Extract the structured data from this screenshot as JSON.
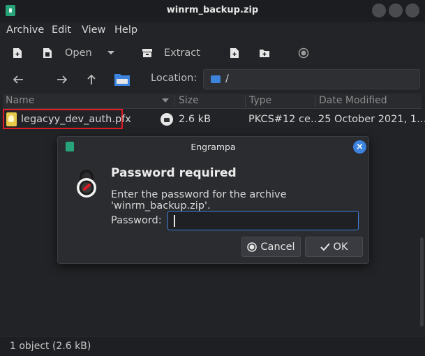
{
  "window": {
    "title": "winrm_backup.zip"
  },
  "menu": [
    "Archive",
    "Edit",
    "View",
    "Help"
  ],
  "toolbar": {
    "open_label": "Open",
    "extract_label": "Extract"
  },
  "location": {
    "label": "Location:",
    "path": "/"
  },
  "columns": {
    "name": "Name",
    "size": "Size",
    "type": "Type",
    "modified": "Date Modified"
  },
  "files": [
    {
      "name": "legacyy_dev_auth.pfx",
      "size": "2.6 kB",
      "type": "PKCS#12 ce…",
      "modified": "25 October 2021, 1…"
    }
  ],
  "status": "1 object (2.6 kB)",
  "dialog": {
    "title": "Engrampa",
    "heading": "Password required",
    "message": "Enter the password for the archive 'winrm_backup.zip'.",
    "password_label": "Password:",
    "password_value": "",
    "cancel_label": "Cancel",
    "ok_label": "OK"
  }
}
